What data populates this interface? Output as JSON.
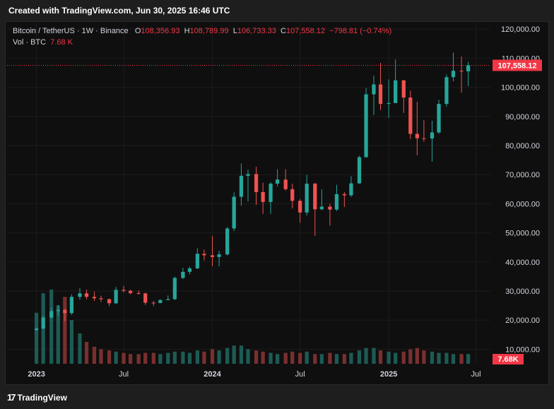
{
  "header": {
    "text": "Created with TradingView.com, Jun 30, 2025 16:46 UTC"
  },
  "legend": {
    "symbol": "Bitcoin / TetherUS · 1W · Binance",
    "open_label": "O",
    "open": "108,356.93",
    "high_label": "H",
    "high": "108,789.99",
    "low_label": "L",
    "low": "106,733.33",
    "close_label": "C",
    "close": "107,558.12",
    "change": "−798.81 (−0.74%)",
    "vol_label": "Vol · BTC",
    "vol": "7.68 K"
  },
  "footer": {
    "brand": "TradingView",
    "logo_icon": "tradingview-logo-icon"
  },
  "colors": {
    "up": "#26a69a",
    "down": "#ef5350",
    "price_line": "#f23645",
    "background": "#0f0f0f"
  },
  "chart_data": {
    "type": "candlestick",
    "y_axis": {
      "ticks": [
        "10,000.00",
        "20,000.00",
        "30,000.00",
        "40,000.00",
        "50,000.00",
        "60,000.00",
        "70,000.00",
        "80,000.00",
        "90,000.00",
        "100,000.00",
        "110,000.00",
        "120,000.00"
      ],
      "ylim": [
        5000,
        122000
      ]
    },
    "x_axis": {
      "ticks": [
        "2023",
        "Jul",
        "2024",
        "Jul",
        "2025",
        "Jul"
      ]
    },
    "last_price_label": "107,558.12",
    "last_price": 107558.12,
    "volume_label": "7.68K",
    "series": [
      {
        "name": "Price",
        "points": [
          {
            "date": "2023-01-01",
            "open": 16600,
            "high": 17400,
            "low": 16500,
            "close": 17100
          },
          {
            "date": "2023-01-15",
            "open": 17100,
            "high": 21400,
            "low": 17000,
            "close": 20900
          },
          {
            "date": "2023-02-01",
            "open": 20900,
            "high": 24200,
            "low": 20700,
            "close": 23100
          },
          {
            "date": "2023-02-15",
            "open": 23100,
            "high": 25200,
            "low": 21400,
            "close": 23500
          },
          {
            "date": "2023-03-01",
            "open": 23500,
            "high": 23900,
            "low": 19600,
            "close": 22400
          },
          {
            "date": "2023-03-15",
            "open": 22400,
            "high": 28900,
            "low": 21800,
            "close": 28000
          },
          {
            "date": "2023-04-01",
            "open": 28000,
            "high": 31000,
            "low": 27000,
            "close": 29200
          },
          {
            "date": "2023-04-15",
            "open": 29200,
            "high": 30500,
            "low": 27200,
            "close": 28000
          },
          {
            "date": "2023-05-01",
            "open": 28000,
            "high": 29800,
            "low": 26600,
            "close": 27500
          },
          {
            "date": "2023-05-15",
            "open": 27500,
            "high": 28400,
            "low": 26200,
            "close": 27200
          },
          {
            "date": "2023-06-01",
            "open": 27200,
            "high": 27400,
            "low": 24800,
            "close": 25800
          },
          {
            "date": "2023-06-15",
            "open": 25800,
            "high": 31400,
            "low": 25500,
            "close": 30400
          },
          {
            "date": "2023-07-01",
            "open": 30400,
            "high": 31800,
            "low": 29500,
            "close": 30100
          },
          {
            "date": "2023-07-15",
            "open": 30100,
            "high": 30400,
            "low": 28900,
            "close": 29300
          },
          {
            "date": "2023-08-01",
            "open": 29300,
            "high": 30200,
            "low": 28800,
            "close": 29200
          },
          {
            "date": "2023-08-15",
            "open": 29200,
            "high": 29400,
            "low": 25200,
            "close": 26000
          },
          {
            "date": "2023-09-01",
            "open": 26000,
            "high": 26600,
            "low": 24900,
            "close": 25900
          },
          {
            "date": "2023-09-15",
            "open": 25900,
            "high": 27200,
            "low": 25800,
            "close": 26900
          },
          {
            "date": "2023-10-01",
            "open": 26900,
            "high": 28500,
            "low": 26800,
            "close": 27200
          },
          {
            "date": "2023-10-15",
            "open": 27200,
            "high": 35000,
            "low": 26900,
            "close": 34500
          },
          {
            "date": "2023-11-01",
            "open": 34500,
            "high": 38000,
            "low": 34100,
            "close": 36600
          },
          {
            "date": "2023-11-15",
            "open": 36600,
            "high": 38400,
            "low": 35700,
            "close": 37800
          },
          {
            "date": "2023-12-01",
            "open": 37800,
            "high": 44700,
            "low": 37500,
            "close": 42800
          },
          {
            "date": "2023-12-15",
            "open": 42800,
            "high": 44300,
            "low": 40500,
            "close": 42300
          },
          {
            "date": "2024-01-01",
            "open": 42300,
            "high": 48900,
            "low": 38500,
            "close": 41700
          },
          {
            "date": "2024-01-15",
            "open": 41700,
            "high": 43800,
            "low": 38500,
            "close": 42600
          },
          {
            "date": "2024-02-01",
            "open": 42600,
            "high": 52000,
            "low": 42200,
            "close": 51500
          },
          {
            "date": "2024-02-15",
            "open": 51500,
            "high": 63900,
            "low": 50600,
            "close": 62400
          },
          {
            "date": "2024-03-01",
            "open": 62400,
            "high": 73800,
            "low": 59300,
            "close": 69600
          },
          {
            "date": "2024-03-15",
            "open": 69600,
            "high": 71700,
            "low": 60800,
            "close": 70200
          },
          {
            "date": "2024-04-01",
            "open": 70200,
            "high": 72700,
            "low": 59600,
            "close": 64000
          },
          {
            "date": "2024-04-15",
            "open": 64000,
            "high": 67200,
            "low": 56500,
            "close": 60600
          },
          {
            "date": "2024-05-01",
            "open": 60600,
            "high": 67400,
            "low": 56500,
            "close": 66900
          },
          {
            "date": "2024-05-15",
            "open": 66900,
            "high": 71900,
            "low": 66000,
            "close": 68300
          },
          {
            "date": "2024-06-01",
            "open": 68300,
            "high": 71900,
            "low": 64500,
            "close": 65000
          },
          {
            "date": "2024-06-15",
            "open": 65000,
            "high": 66900,
            "low": 58400,
            "close": 61000
          },
          {
            "date": "2024-07-01",
            "open": 61000,
            "high": 61600,
            "low": 53500,
            "close": 57000
          },
          {
            "date": "2024-07-15",
            "open": 57000,
            "high": 69900,
            "low": 56000,
            "close": 66900
          },
          {
            "date": "2024-08-01",
            "open": 66900,
            "high": 67200,
            "low": 49000,
            "close": 58100
          },
          {
            "date": "2024-08-15",
            "open": 58100,
            "high": 64900,
            "low": 57800,
            "close": 59000
          },
          {
            "date": "2024-09-01",
            "open": 59000,
            "high": 60000,
            "low": 52500,
            "close": 58000
          },
          {
            "date": "2024-09-15",
            "open": 58000,
            "high": 66500,
            "low": 57500,
            "close": 63300
          },
          {
            "date": "2024-10-01",
            "open": 63300,
            "high": 64000,
            "low": 58900,
            "close": 62900
          },
          {
            "date": "2024-10-15",
            "open": 62900,
            "high": 69500,
            "low": 62400,
            "close": 67000
          },
          {
            "date": "2024-11-01",
            "open": 67000,
            "high": 76500,
            "low": 66800,
            "close": 76000
          },
          {
            "date": "2024-11-15",
            "open": 76000,
            "high": 99800,
            "low": 75800,
            "close": 97600
          },
          {
            "date": "2024-12-01",
            "open": 97600,
            "high": 104000,
            "low": 90500,
            "close": 101000
          },
          {
            "date": "2024-12-15",
            "open": 101000,
            "high": 108400,
            "low": 92200,
            "close": 94300
          },
          {
            "date": "2025-01-01",
            "open": 94300,
            "high": 102700,
            "low": 89500,
            "close": 94600
          },
          {
            "date": "2025-01-15",
            "open": 94600,
            "high": 109600,
            "low": 96000,
            "close": 102400
          },
          {
            "date": "2025-02-01",
            "open": 102400,
            "high": 102500,
            "low": 91200,
            "close": 96500
          },
          {
            "date": "2025-02-15",
            "open": 96500,
            "high": 98900,
            "low": 82200,
            "close": 84000
          },
          {
            "date": "2025-03-01",
            "open": 84000,
            "high": 95000,
            "low": 76600,
            "close": 82500
          },
          {
            "date": "2025-03-15",
            "open": 82500,
            "high": 88700,
            "low": 81300,
            "close": 82400
          },
          {
            "date": "2025-04-01",
            "open": 82400,
            "high": 88500,
            "low": 74500,
            "close": 84500
          },
          {
            "date": "2025-04-15",
            "open": 84500,
            "high": 95700,
            "low": 84000,
            "close": 94300
          },
          {
            "date": "2025-05-01",
            "open": 94300,
            "high": 104400,
            "low": 93400,
            "close": 103500
          },
          {
            "date": "2025-05-15",
            "open": 103500,
            "high": 111900,
            "low": 102100,
            "close": 105700
          },
          {
            "date": "2025-06-01",
            "open": 105700,
            "high": 110600,
            "low": 98200,
            "close": 105500
          },
          {
            "date": "2025-06-15",
            "open": 105500,
            "high": 108800,
            "low": 100400,
            "close": 107558
          }
        ]
      }
    ],
    "volume_values": [
      42,
      58,
      61,
      48,
      55,
      36,
      25,
      18,
      14,
      12,
      11,
      10,
      9,
      8,
      8,
      9,
      9,
      8,
      9,
      10,
      10,
      9,
      11,
      10,
      12,
      11,
      13,
      15,
      15,
      12,
      11,
      10,
      9,
      8,
      9,
      10,
      9,
      10,
      8,
      8,
      9,
      8,
      8,
      9,
      11,
      13,
      13,
      11,
      10,
      9,
      10,
      12,
      13,
      11,
      10,
      9,
      9,
      8,
      8,
      8
    ]
  }
}
